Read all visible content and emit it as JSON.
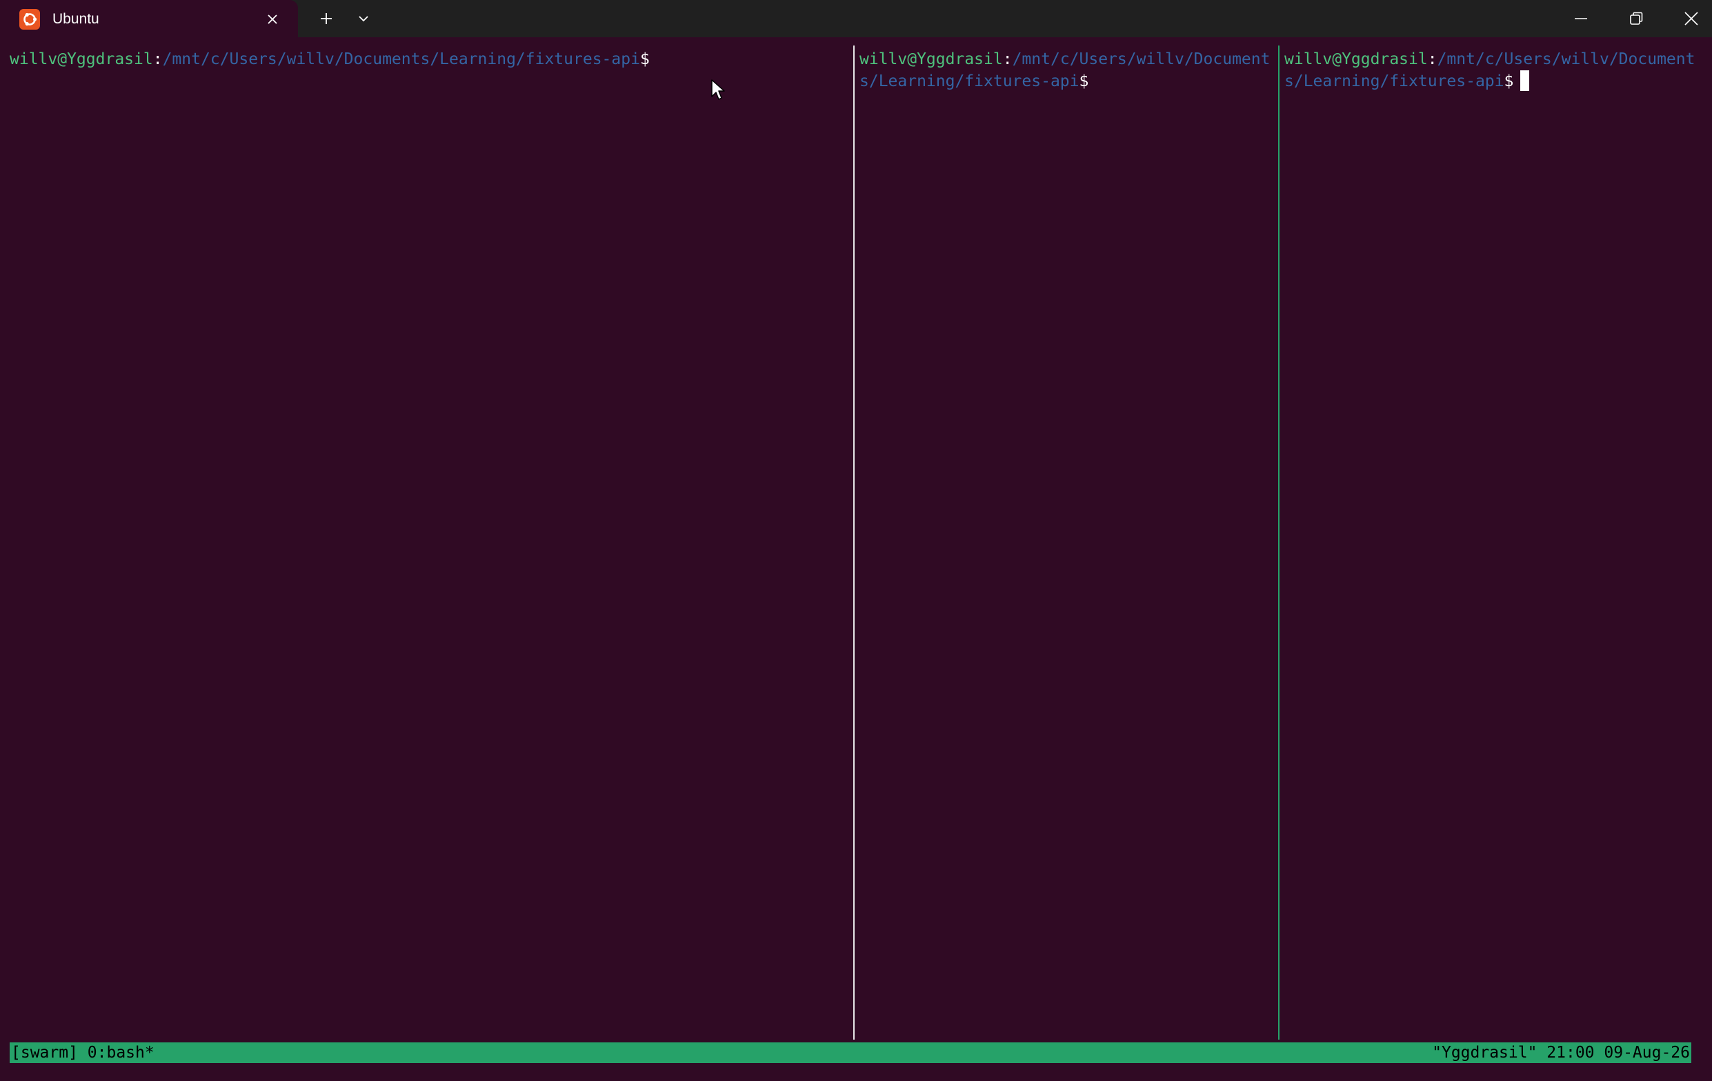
{
  "window": {
    "tab_title": "Ubuntu",
    "icons": {
      "app": "ubuntu-logo-icon",
      "tab_close": "close-icon",
      "new_tab": "plus-icon",
      "dropdown": "chevron-down-icon",
      "minimize": "minimize-icon",
      "maximize": "restore-icon",
      "close": "close-icon"
    }
  },
  "colors": {
    "terminal_bg": "#300a24",
    "prompt_user": "#4ec27d",
    "prompt_path": "#3465a4",
    "status_bar": "#26a269",
    "ubuntu_orange": "#e95420"
  },
  "panes": [
    {
      "user_host": "willv@Yggdrasil",
      "separator": ":",
      "path": "/mnt/c/Users/willv/Documents/Learning/fixtures-api",
      "prompt_symbol": "$",
      "active": false
    },
    {
      "user_host": "willv@Yggdrasil",
      "separator": ":",
      "path": "/mnt/c/Users/willv/Documents/Learning/fixtures-api",
      "prompt_symbol": "$",
      "active": false
    },
    {
      "user_host": "willv@Yggdrasil",
      "separator": ":",
      "path": "/mnt/c/Users/willv/Documents/Learning/fixtures-api",
      "prompt_symbol": "$",
      "active": true
    }
  ],
  "status_bar": {
    "left": "[swarm] 0:bash*",
    "right": "\"Yggdrasil\" 21:00 09-Aug-26"
  }
}
